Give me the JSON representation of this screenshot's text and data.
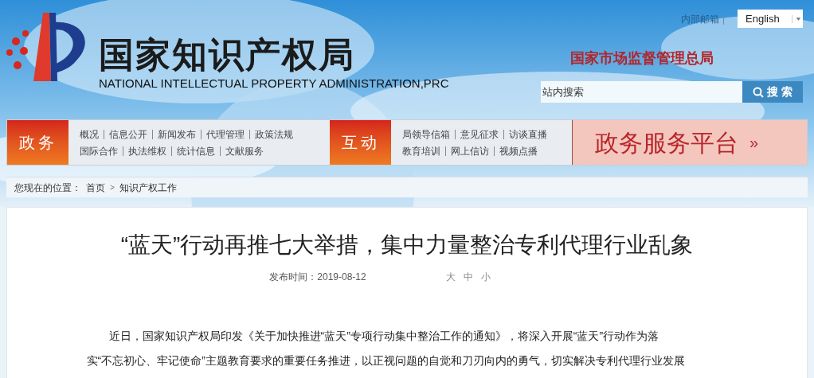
{
  "header": {
    "title_cn": "国家知识产权局",
    "title_en": "NATIONAL INTELLECTUAL PROPERTY ADMINISTRATION,PRC",
    "mail_link": "内部邮箱",
    "separator": "|",
    "language": "English",
    "parent_agency": "国家市场监督管理总局",
    "search": {
      "placeholder": "站内搜索",
      "button": "搜 索"
    }
  },
  "nav": {
    "sections": [
      {
        "label": "政务",
        "rows": [
          [
            "概况",
            "信息公开",
            "新闻发布",
            "代理管理",
            "政策法规"
          ],
          [
            "国际合作",
            "执法维权",
            "统计信息",
            "文献服务"
          ]
        ]
      },
      {
        "label": "互动",
        "rows": [
          [
            "局领导信箱",
            "意见征求",
            "访谈直播"
          ],
          [
            "教育培训",
            "网上信访",
            "视频点播"
          ]
        ]
      }
    ],
    "platform": {
      "label": "政务服务平台",
      "arrow": "»"
    }
  },
  "breadcrumb": {
    "prefix": "您现在的位置：",
    "items": [
      "首页",
      "知识产权工作"
    ],
    "separator": ">"
  },
  "article": {
    "title": "“蓝天”行动再推七大举措，集中力量整治专利代理行业乱象",
    "date_label": "发布时间：2019-08-12",
    "font_sizes": [
      "大",
      "中",
      "小"
    ],
    "paragraph_lines": [
      "近日，国家知识产权局印发《关于加快推进“蓝天”专项行动集中整治工作的通知》，将深入开展“蓝天”行动作为落",
      "实“不忘初心、牢记使命”主题教育要求的重要任务推进，以正视问题的自觉和刀刃向内的勇气，切实解决专利代理行业发展"
    ]
  }
}
